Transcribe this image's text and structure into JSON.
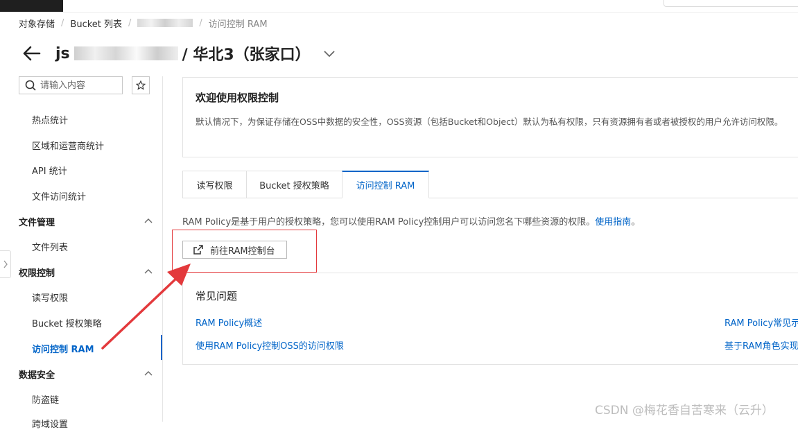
{
  "breadcrumb": {
    "root": "对象存储",
    "bucket_list": "Bucket 列表",
    "current": "访问控制 RAM"
  },
  "title": {
    "prefix": "js",
    "suffix": "/ 华北3（张家口）"
  },
  "search": {
    "placeholder": "请输入内容"
  },
  "sidebar": {
    "items": [
      {
        "label": "热点统计"
      },
      {
        "label": "区域和运营商统计"
      },
      {
        "label": "API 统计"
      },
      {
        "label": "文件访问统计"
      }
    ],
    "groups": {
      "file_mgmt": {
        "label": "文件管理",
        "items": [
          {
            "label": "文件列表"
          }
        ]
      },
      "access": {
        "label": "权限控制",
        "items": [
          {
            "label": "读写权限"
          },
          {
            "label": "Bucket 授权策略"
          },
          {
            "label": "访问控制 RAM"
          }
        ]
      },
      "data_security": {
        "label": "数据安全",
        "items": [
          {
            "label": "防盗链"
          },
          {
            "label": "跨域设置"
          }
        ]
      }
    }
  },
  "welcome": {
    "title": "欢迎使用权限控制",
    "desc": "默认情况下，为保证存储在OSS中数据的安全性，OSS资源（包括Bucket和Object）默认为私有权限，只有资源拥有者或者被授权的用户允许访问权限。"
  },
  "tabs": [
    {
      "label": "读写权限"
    },
    {
      "label": "Bucket 授权策略"
    },
    {
      "label": "访问控制 RAM"
    }
  ],
  "ram": {
    "desc": "RAM Policy是基于用户的授权策略，您可以使用RAM Policy控制用户可以访问您名下哪些资源的权限。",
    "guide_link": "使用指南",
    "period": "。",
    "button": "前往RAM控制台"
  },
  "faq": {
    "title": "常见问题",
    "links": [
      "RAM Policy概述",
      "使用RAM Policy控制OSS的访问权限",
      "RAM Policy常见示",
      "基于RAM角色实现"
    ]
  },
  "watermark": "CSDN @梅花香自苦寒来（云升）",
  "colors": {
    "accent": "#0064c8",
    "annotation": "#e3393c"
  }
}
